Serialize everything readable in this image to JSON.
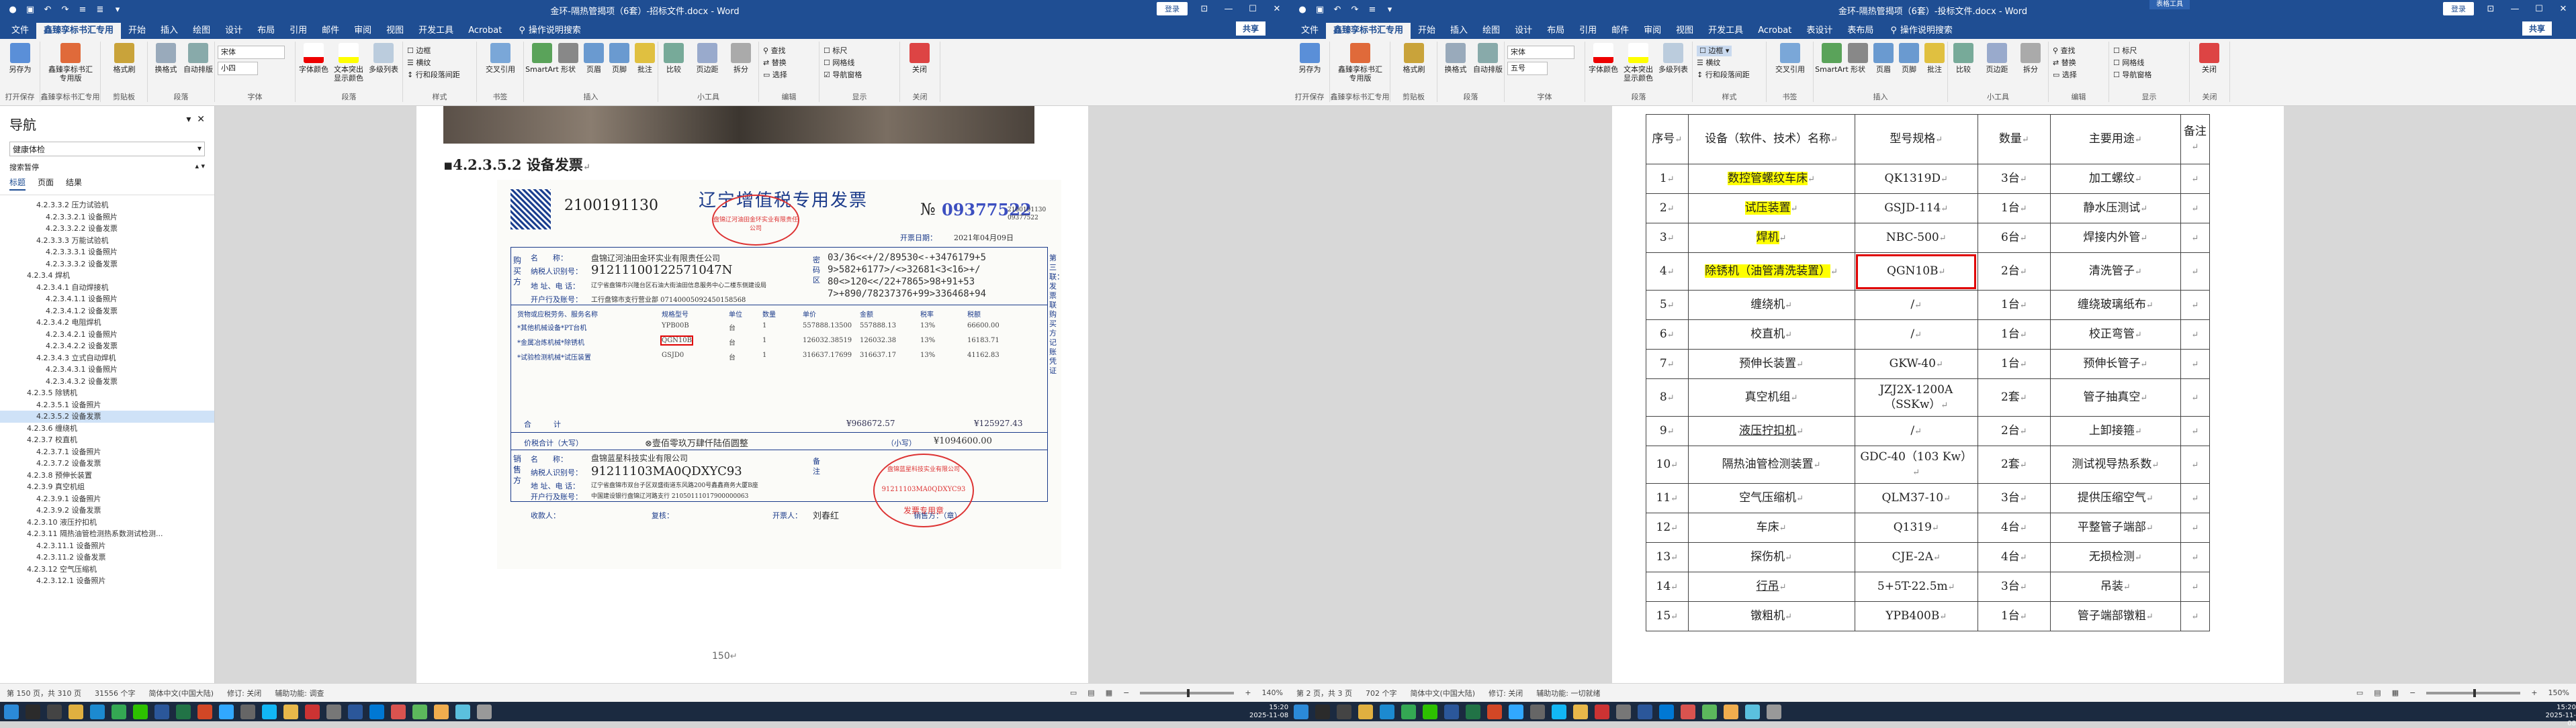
{
  "colors": {
    "title_bar": "#1f4e93",
    "highlight": "#ffff00",
    "annotation_red": "#e00000",
    "invoice_ink": "#1a3a8a",
    "stamp_red": "#d33"
  },
  "left": {
    "title": "金环-隔热管揭项（6套）-招标文件.docx - Word",
    "login": "登录",
    "tabs": [
      "文件",
      "鑫臻孪标书汇专用",
      "开始",
      "插入",
      "绘图",
      "设计",
      "布局",
      "引用",
      "邮件",
      "审阅",
      "视图",
      "开发工具",
      "Acrobat"
    ],
    "search": "操作说明搜索",
    "share": "共享",
    "ribbon": {
      "group_labels": [
        "打开保存",
        "鑫臻孪标书汇专用",
        "剪贴板",
        "字体",
        "段落",
        "样式",
        "编辑",
        "书签",
        "插入",
        "小工具",
        "编辑",
        "显示",
        "关闭"
      ],
      "buttons": [
        "另存为",
        "鑫臻孪标书汇专用版",
        "格式刷",
        "换格式",
        "自动排版",
        "字体颜色",
        "文本突出显示颜色",
        "多级列表",
        "交叉引用",
        "SmartArt",
        "形状",
        "页眉",
        "页脚",
        "批注",
        "信息框",
        "页码",
        "比较",
        "页边距",
        "拆分",
        "查找",
        "替换",
        "选择",
        "标尺",
        "网格线",
        "导航窗格",
        "关闭"
      ],
      "font_name": "宋体",
      "font_size": "小四",
      "items": [
        "边框",
        "横纹",
        "行和段落间距"
      ]
    },
    "nav": {
      "title": "导航",
      "search_value": "健康体检",
      "small_label": "搜索暂停",
      "tabs": [
        "标题",
        "页面",
        "结果"
      ],
      "tree": [
        "4.2.3.3.2 压力试验机",
        "4.2.3.3.2.1 设备照片",
        "4.2.3.3.2.2 设备发票",
        "4.2.3.3.3 万能试验机",
        "4.2.3.3.3.1 设备照片",
        "4.2.3.3.3.2 设备发票",
        "4.2.3.4 焊机",
        "4.2.3.4.1 自动焊接机",
        "4.2.3.4.1.1 设备照片",
        "4.2.3.4.1.2 设备发票",
        "4.2.3.4.2 电阻焊机",
        "4.2.3.4.2.1 设备照片",
        "4.2.3.4.2.2 设备发票",
        "4.2.3.4.3 立式自动焊机",
        "4.2.3.4.3.1 设备照片",
        "4.2.3.4.3.2 设备发票",
        "4.2.3.5 除锈机",
        "4.2.3.5.1 设备照片",
        "4.2.3.5.2 设备发票",
        "4.2.3.6 缠绕机",
        "4.2.3.7 校直机",
        "4.2.3.7.1 设备照片",
        "4.2.3.7.2 设备发票",
        "4.2.3.8 预伸长装置",
        "4.2.3.9 真空机组",
        "4.2.3.9.1 设备照片",
        "4.2.3.9.2 设备发票",
        "4.2.3.10 液压拧扣机",
        "4.2.3.11 隔热油管检测热系数测试检测...",
        "4.2.3.11.1 设备照片",
        "4.2.3.11.2 设备发票",
        "4.2.3.12 空气压缩机",
        "4.2.3.12.1 设备照片"
      ]
    },
    "doc": {
      "heading": "4.2.3.5.2 设备发票",
      "invoice": {
        "title": "辽宁增值税专用发票",
        "code": "2100191130",
        "number_label": "№",
        "number": "09377522",
        "number_small": "2100191130",
        "number_small2": "09377522",
        "date_label": "开票日期：",
        "date": "2021年04月09日",
        "buyer_label": "购买方",
        "buyer_name_label": "名　　称：",
        "buyer_name": "盘锦辽河油田金环实业有限责任公司",
        "taxid_label": "纳税人识别号：",
        "taxid": "91211100122571047N",
        "addr_label": "地 址、电 话：",
        "addr": "辽宁省盘锦市兴隆台区石油大街油田信息服务中心二楼东侧建设局",
        "bank_label": "开户行及账号：",
        "bank": "工行盘锦市支行营业部 07140005092450158568",
        "cipher": [
          "03/36<<+/2/89530<-+3476179+5",
          "9>582+6177>/<>32681<3<16>+/",
          "80<>120<</22+7865>98+91+53",
          "7>+890/78237376+99>336468+94"
        ],
        "password_label": "密码区",
        "col_headers": [
          "货物或应税劳务、服务名称",
          "规格型号",
          "单位",
          "数量",
          "单价",
          "金额",
          "税率",
          "税额"
        ],
        "rows": [
          [
            "*其他机械设备*PT台机",
            "YPB00B",
            "台",
            "1",
            "557888.13500",
            "557888.13",
            "13%",
            "66600.00"
          ],
          [
            "*金属冶炼机械*除锈机",
            "QGN10B",
            "台",
            "1",
            "126032.38519",
            "126032.38",
            "13%",
            "16183.71"
          ],
          [
            "*试验检测机械*试压装置",
            "GSJD0",
            "台",
            "1",
            "316637.17699",
            "316637.17",
            "13%",
            "41162.83"
          ]
        ],
        "total_label": "合　　　计",
        "total_amount": "¥968672.57",
        "total_tax": "¥125927.43",
        "sum_label": "价税合计（大写）",
        "sum_cn": "⊗壹佰零玖万肆仟陆佰圆整",
        "sum_small": "（小写）",
        "sum_num": "¥1094600.00",
        "seller_label": "销售方",
        "seller_name": "盘锦蓝星科技实业有限公司",
        "seller_taxid": "91211103MA0QDXYC93",
        "seller_addr": "辽宁省盘锦市双台子区双盛街道东风路200号鑫鑫商务大厦B座",
        "seller_bank": "中国建设银行盘锦辽河路支行 21050111017900000063",
        "remark_label": "备注",
        "payee_label": "收款人：",
        "checker_label": "复核：",
        "drawer_label": "开票人：",
        "drawer": "刘春红",
        "seal_label": "销售方：（章）",
        "side_text": "第三联：发票联 购买方记账凭证",
        "stamp1": "盘锦辽河油田金环实业有限责任公司",
        "stamp2_top": "盘锦蓝星科技实业有限公司",
        "stamp2_id": "91211103MA0QDXYC93",
        "stamp2_bottom": "发票专用章"
      },
      "page_number": "150"
    },
    "status": {
      "page": "第 150 页，共 310 页",
      "words": "31556 个字",
      "lang": "简体中文(中国大陆)",
      "track": "修订: 关闭",
      "access": "辅助功能: 调查",
      "zoom": "140%"
    },
    "clock": {
      "time": "15:20",
      "date": "2025-11-08"
    }
  },
  "right": {
    "title": "金环-隔热管揭项（6套）-投标文件.docx - Word",
    "context": "表格工具",
    "login": "登录",
    "tabs": [
      "文件",
      "鑫臻孪标书汇专用",
      "开始",
      "插入",
      "绘图",
      "设计",
      "布局",
      "引用",
      "邮件",
      "审阅",
      "视图",
      "开发工具",
      "Acrobat",
      "表设计",
      "表布局"
    ],
    "search": "操作说明搜索",
    "share": "共享",
    "ribbon": {
      "font_name": "宋体",
      "font_size": "五号",
      "items": [
        "边框",
        "横纹",
        "行和段落间距"
      ]
    },
    "table": {
      "headers": [
        "序号",
        "设备（软件、技术）名称",
        "型号规格",
        "数量",
        "主要用途",
        "备注"
      ],
      "rows": [
        {
          "no": "1",
          "name": "数控管螺纹车床",
          "hl": true,
          "model": "QK1319D",
          "qty": "3台",
          "use": "加工螺纹",
          "box": false
        },
        {
          "no": "2",
          "name": "试压装置",
          "hl": true,
          "model": "GSJD-114",
          "qty": "1台",
          "use": "静水压测试",
          "box": false
        },
        {
          "no": "3",
          "name": "焊机",
          "hl": true,
          "model": "NBC-500",
          "qty": "6台",
          "use": "焊接内外管",
          "box": false
        },
        {
          "no": "4",
          "name": "除锈机（油管清洗装置）",
          "hl": true,
          "model": "QGN10B",
          "qty": "2台",
          "use": "清洗管子",
          "box": true
        },
        {
          "no": "5",
          "name": "缠绕机",
          "hl": false,
          "model": "/",
          "qty": "1台",
          "use": "缠绕玻璃纸布",
          "box": false
        },
        {
          "no": "6",
          "name": "校直机",
          "hl": false,
          "model": "/",
          "qty": "1台",
          "use": "校正弯管",
          "box": false
        },
        {
          "no": "7",
          "name": "预伸长装置",
          "hl": false,
          "model": "GKW-40",
          "qty": "1台",
          "use": "预伸长管子",
          "box": false
        },
        {
          "no": "8",
          "name": "真空机组",
          "hl": false,
          "model": "JZJ2X-1200A（SSKw）",
          "qty": "2套",
          "use": "管子抽真空",
          "box": false
        },
        {
          "no": "9",
          "name": "液压拧扣机",
          "hl": false,
          "model": "/",
          "qty": "2台",
          "use": "上卸接箍",
          "box": false
        },
        {
          "no": "10",
          "name": "隔热油管检测装置",
          "hl": false,
          "model": "GDC-40（103 Kw）",
          "qty": "2套",
          "use": "测试视导热系数",
          "box": false
        },
        {
          "no": "11",
          "name": "空气压缩机",
          "hl": false,
          "model": "QLM37-10",
          "qty": "3台",
          "use": "提供压缩空气",
          "box": false
        },
        {
          "no": "12",
          "name": "车床",
          "hl": false,
          "model": "Q1319",
          "qty": "4台",
          "use": "平整管子端部",
          "box": false
        },
        {
          "no": "13",
          "name": "探伤机",
          "hl": false,
          "model": "CJE-2A",
          "qty": "4台",
          "use": "无损检测",
          "box": false
        },
        {
          "no": "14",
          "name": "行吊",
          "hl": false,
          "model": "5+5T-22.5m",
          "qty": "3台",
          "use": "吊装",
          "box": false
        },
        {
          "no": "15",
          "name": "镦粗机",
          "hl": false,
          "model": "YPB400B",
          "qty": "1台",
          "use": "管子端部镦粗",
          "box": false
        }
      ]
    },
    "status": {
      "page": "第 2 页，共 3 页",
      "words": "702 个字",
      "lang": "简体中文(中国大陆)",
      "track": "修订: 关闭",
      "access": "辅助功能: 一切就绪",
      "zoom": "150%"
    },
    "clock": {
      "time": "15:20",
      "date": "2025-11-08"
    }
  }
}
